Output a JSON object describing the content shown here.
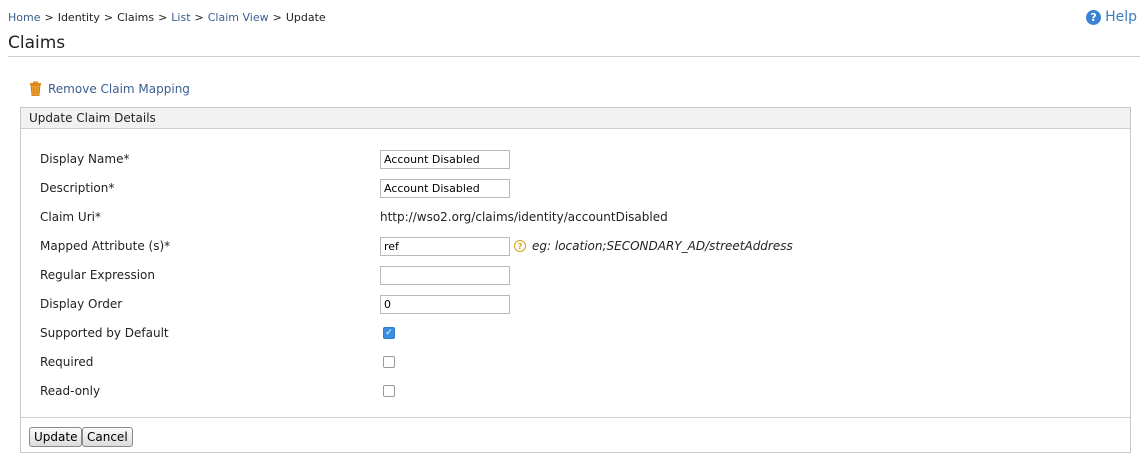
{
  "breadcrumb": {
    "home": "Home",
    "identity": "Identity",
    "claims": "Claims",
    "list": "List",
    "claim_view": "Claim View",
    "current": "Update"
  },
  "help_label": "Help",
  "page_title": "Claims",
  "remove_mapping_label": "Remove Claim Mapping",
  "panel_title": "Update Claim Details",
  "form": {
    "display_name": {
      "label": "Display Name*",
      "value": "Account Disabled"
    },
    "description": {
      "label": "Description*",
      "value": "Account Disabled"
    },
    "claim_uri": {
      "label": "Claim Uri*",
      "value": "http://wso2.org/claims/identity/accountDisabled"
    },
    "mapped_attribute": {
      "label": "Mapped Attribute (s)*",
      "value": "ref",
      "hint": "eg: location;SECONDARY_AD/streetAddress"
    },
    "regular_expression": {
      "label": "Regular Expression",
      "value": ""
    },
    "display_order": {
      "label": "Display Order",
      "value": "0"
    },
    "supported_by_default": {
      "label": "Supported by Default",
      "checked": true
    },
    "required": {
      "label": "Required",
      "checked": false
    },
    "read_only": {
      "label": "Read-only",
      "checked": false
    }
  },
  "buttons": {
    "update": "Update",
    "cancel": "Cancel"
  },
  "colors": {
    "link": "#3a5f8f",
    "accent": "#3b82d6",
    "hint": "#d7a21c"
  }
}
